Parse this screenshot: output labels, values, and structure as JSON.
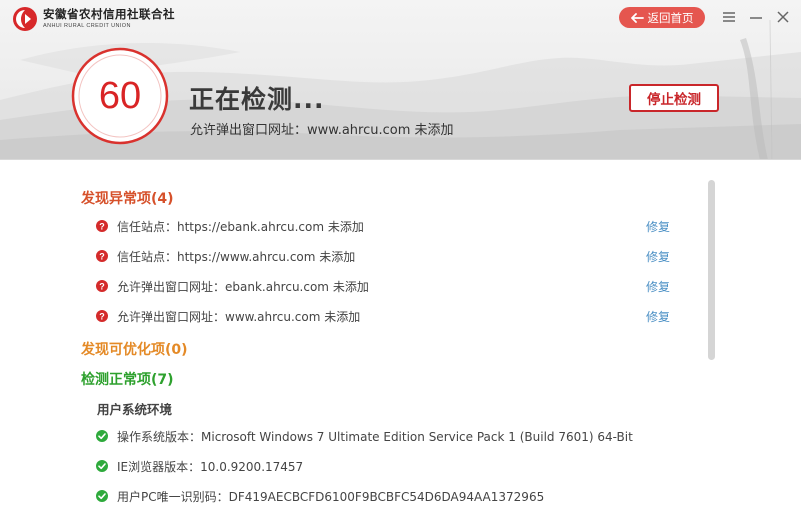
{
  "brand": {
    "name_cn": "安徽省农村信用社联合社",
    "name_en": "ANHUI RURAL CREDIT UNION"
  },
  "header": {
    "back_label": "返回首页",
    "score": "60",
    "status_title": "正在检测...",
    "status_sub": "允许弹出窗口网址：www.ahrcu.com 未添加",
    "stop_label": "停止检测"
  },
  "icons": {
    "back": "arrow-left-icon",
    "menu": "menu-icon",
    "minimize": "minimize-icon",
    "close": "close-icon",
    "warning": "question-circle-icon",
    "ok": "check-circle-icon"
  },
  "colors": {
    "accent_red": "#d92425",
    "abnormal": "#d6512b",
    "optimize": "#e48a27",
    "normal": "#2ea12e",
    "link": "#4a8fc4"
  },
  "sections": {
    "abnormal": {
      "title": "发现异常项(4)",
      "fix_label": "修复",
      "items": [
        "信任站点：https://ebank.ahrcu.com 未添加",
        "信任站点：https://www.ahrcu.com 未添加",
        "允许弹出窗口网址：ebank.ahrcu.com 未添加",
        "允许弹出窗口网址：www.ahrcu.com 未添加"
      ]
    },
    "optimize": {
      "title": "发现可优化项(0)"
    },
    "normal": {
      "title": "检测正常项(7)",
      "group_label": "用户系统环境",
      "items": [
        "操作系统版本：Microsoft Windows 7 Ultimate Edition Service Pack 1 (Build 7601) 64-Bit",
        "IE浏览器版本：10.0.9200.17457",
        "用户PC唯一识别码：DF419AECBCFD6100F9BCBFC54D6DA94AA1372965"
      ]
    }
  }
}
